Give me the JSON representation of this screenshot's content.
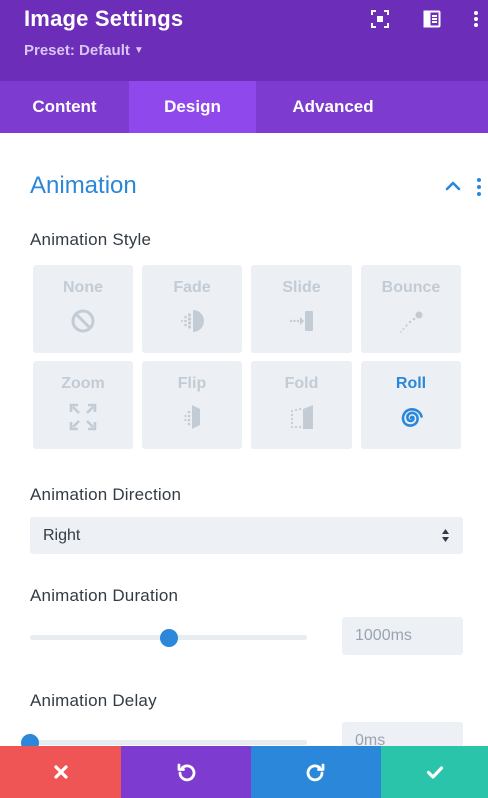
{
  "header": {
    "title": "Image Settings",
    "preset": "Preset: Default",
    "bg_color": "#6c2eb9",
    "icons": [
      "focus-icon",
      "sidebar-layout-icon",
      "more-vertical-icon"
    ]
  },
  "tabs": [
    {
      "label": "Content",
      "active": false
    },
    {
      "label": "Design",
      "active": true
    },
    {
      "label": "Advanced",
      "active": false
    }
  ],
  "section": {
    "title": "Animation",
    "accent": "#2b87da"
  },
  "animation_style": {
    "label": "Animation Style",
    "options": [
      {
        "name": "None",
        "icon": "none-icon",
        "selected": false
      },
      {
        "name": "Fade",
        "icon": "fade-icon",
        "selected": false
      },
      {
        "name": "Slide",
        "icon": "slide-icon",
        "selected": false
      },
      {
        "name": "Bounce",
        "icon": "bounce-icon",
        "selected": false
      },
      {
        "name": "Zoom",
        "icon": "zoom-icon",
        "selected": false
      },
      {
        "name": "Flip",
        "icon": "flip-icon",
        "selected": false
      },
      {
        "name": "Fold",
        "icon": "fold-icon",
        "selected": false
      },
      {
        "name": "Roll",
        "icon": "roll-icon",
        "selected": true
      }
    ]
  },
  "animation_direction": {
    "label": "Animation Direction",
    "value": "Right"
  },
  "animation_duration": {
    "label": "Animation Duration",
    "value": "1000ms",
    "slider_fraction": 0.5
  },
  "animation_delay": {
    "label": "Animation Delay",
    "value": "0ms",
    "slider_fraction": 0.0
  },
  "footer": {
    "buttons": [
      {
        "name": "cancel",
        "icon": "close-icon",
        "color": "#ef5555"
      },
      {
        "name": "undo",
        "icon": "undo-icon",
        "color": "#7e3bd0"
      },
      {
        "name": "redo",
        "icon": "redo-icon",
        "color": "#2b87da"
      },
      {
        "name": "save",
        "icon": "check-icon",
        "color": "#29c4a9"
      }
    ]
  }
}
